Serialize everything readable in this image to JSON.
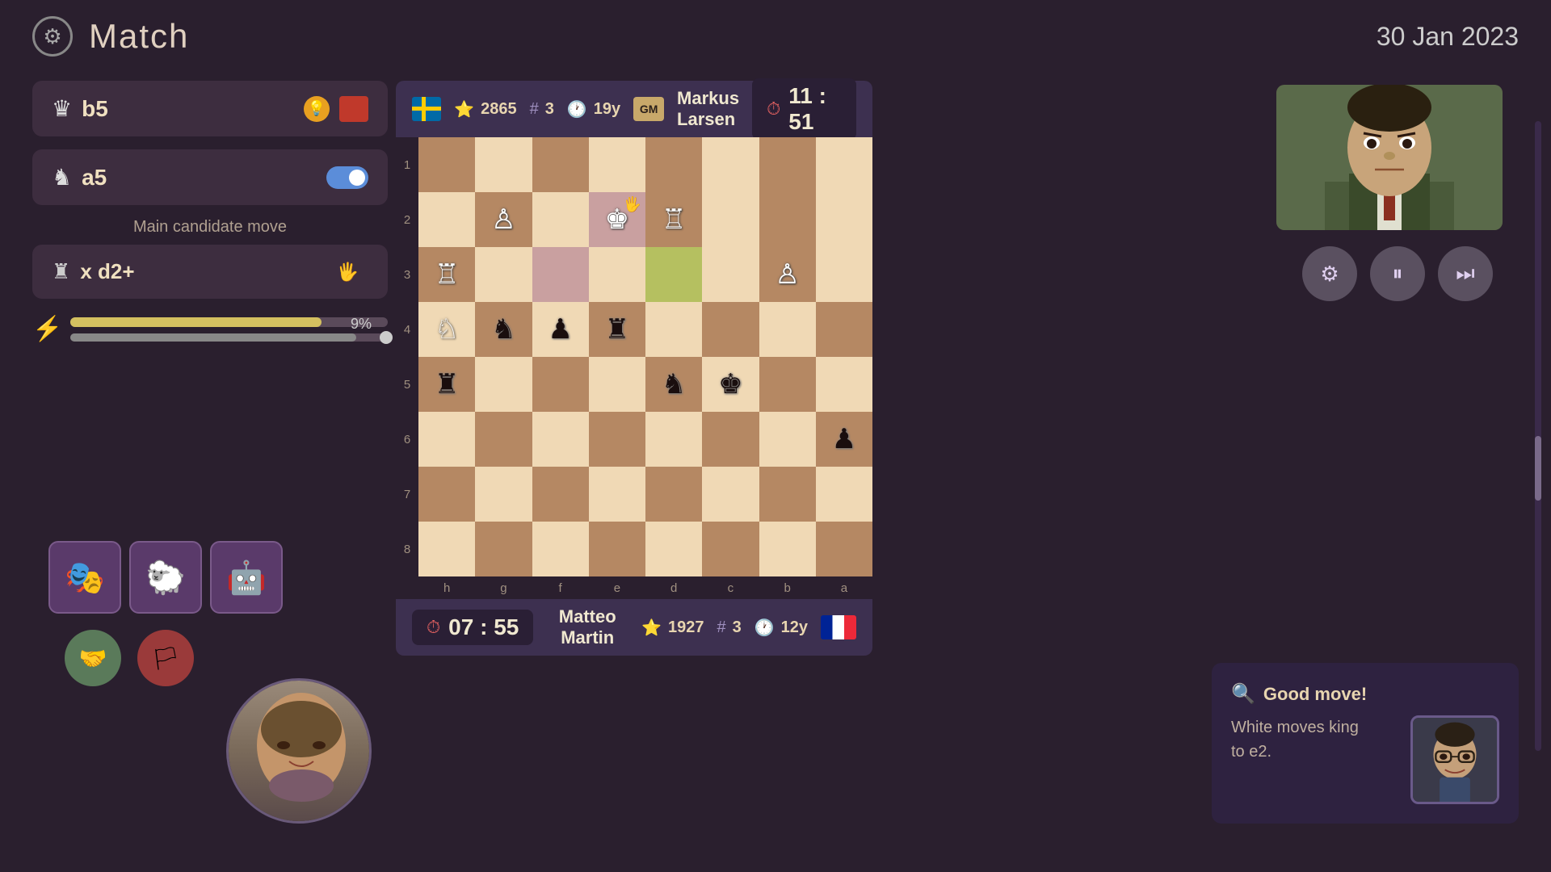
{
  "header": {
    "title": "Match",
    "date": "30 Jan 2023",
    "gear_label": "⚙"
  },
  "top_player": {
    "flag": "sweden",
    "rating": "2865",
    "rank": "3",
    "age": "19y",
    "title": "GM",
    "name": "Markus Larsen",
    "timer": "11 : 51"
  },
  "bottom_player": {
    "flag": "france",
    "timer": "07 : 55",
    "name": "Matteo Martin",
    "rating": "1927",
    "rank": "3",
    "age": "12y"
  },
  "moves": [
    {
      "piece": "♛",
      "notation": "b5",
      "has_hint": true,
      "has_red": true
    },
    {
      "piece": "♞",
      "notation": "a5",
      "has_toggle": true
    }
  ],
  "candidate": {
    "label": "Main candidate move",
    "piece": "♜",
    "notation": "x d2+",
    "has_hand": true,
    "has_toggle": true
  },
  "progress": {
    "value1": "79",
    "value2": "90",
    "percent_label": "9%"
  },
  "analysis": {
    "good_move_label": "Good move!",
    "text": "White moves king\nto e2."
  },
  "controls": {
    "settings_icon": "⚙",
    "pause_icon": "⏸",
    "skip_icon": "⏭"
  },
  "board": {
    "ranks": [
      "1",
      "2",
      "3",
      "4",
      "5",
      "6",
      "7",
      "8"
    ],
    "files": [
      "h",
      "g",
      "f",
      "e",
      "d",
      "c",
      "b",
      "a"
    ]
  }
}
